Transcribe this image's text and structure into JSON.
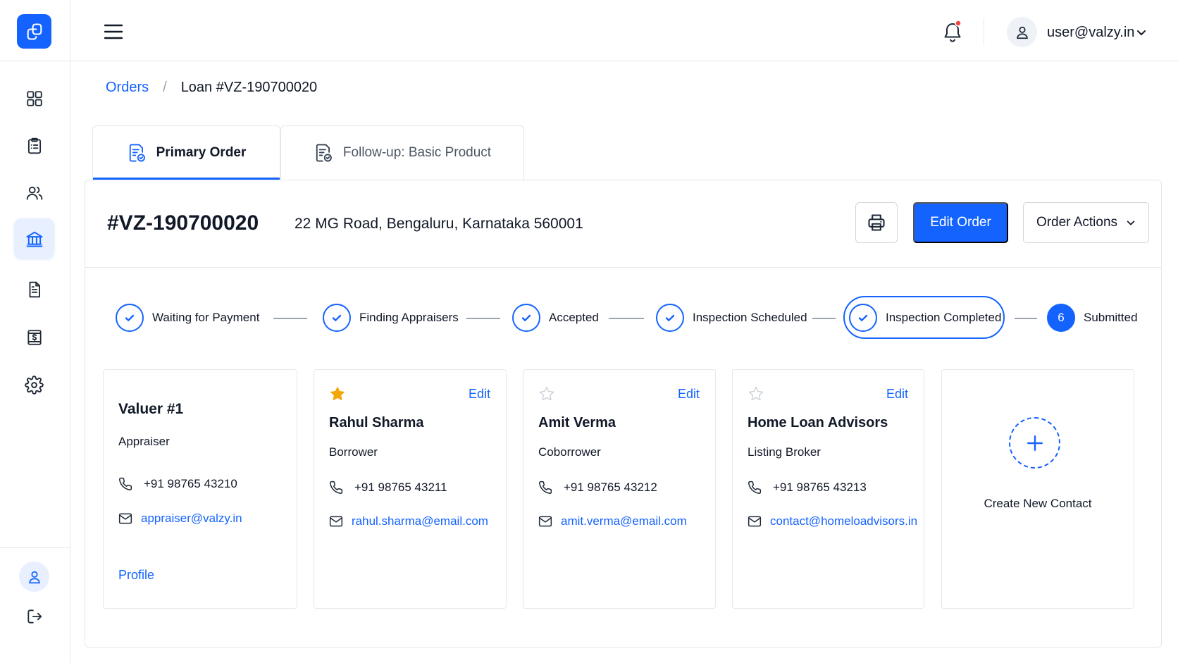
{
  "app": {
    "logo_icon": "copy-files-icon",
    "accent": "#1463ff"
  },
  "sidebar": {
    "items": [
      {
        "icon": "grid-icon",
        "active": false
      },
      {
        "icon": "clipboard-list-icon",
        "active": false
      },
      {
        "icon": "users-icon",
        "active": false
      },
      {
        "icon": "bank-icon",
        "active": true
      },
      {
        "icon": "document-icon",
        "active": false
      },
      {
        "icon": "dollar-invoice-icon",
        "active": false
      },
      {
        "icon": "gear-icon",
        "active": false
      }
    ],
    "bottom": [
      {
        "icon": "user-icon"
      },
      {
        "icon": "logout-icon"
      }
    ]
  },
  "header": {
    "user_email": "user@valzy.in",
    "notification_dot_color": "#ef4444"
  },
  "breadcrumb": {
    "link": "Orders",
    "separator": "/",
    "current": "Loan #VZ-190700020"
  },
  "tabs": [
    {
      "label": "Primary Order",
      "active": true
    },
    {
      "label": "Follow-up: Basic Product",
      "active": false
    }
  ],
  "order": {
    "id": "#VZ-190700020",
    "address": "22 MG Road, Bengaluru, Karnataka 560001",
    "edit_label": "Edit Order",
    "actions_label": "Order Actions"
  },
  "steps": [
    {
      "label": "Waiting for Payment",
      "status": "done"
    },
    {
      "label": "Finding Appraisers",
      "status": "done"
    },
    {
      "label": "Accepted",
      "status": "done"
    },
    {
      "label": "Inspection Scheduled",
      "status": "done"
    },
    {
      "label": "Inspection Completed",
      "status": "current-done"
    },
    {
      "label": "Submitted",
      "status": "pending",
      "number": "6"
    }
  ],
  "contacts": {
    "valuer": {
      "name": "Valuer #1",
      "role": "Appraiser",
      "phone": "+91 98765 43210",
      "email": "appraiser@valzy.in",
      "profile_label": "Profile"
    },
    "cards": [
      {
        "name": "Rahul Sharma",
        "role": "Borrower",
        "phone": "+91 98765 43211",
        "email": "rahul.sharma@email.com",
        "starred": true,
        "edit_label": "Edit"
      },
      {
        "name": "Amit Verma",
        "role": "Coborrower",
        "phone": "+91 98765 43212",
        "email": "amit.verma@email.com",
        "starred": false,
        "edit_label": "Edit"
      },
      {
        "name": "Home Loan Advisors",
        "role": "Listing Broker",
        "phone": "+91 98765 43213",
        "email": "contact@homeloadvisors.in",
        "starred": false,
        "edit_label": "Edit"
      }
    ],
    "create_label": "Create New Contact"
  }
}
